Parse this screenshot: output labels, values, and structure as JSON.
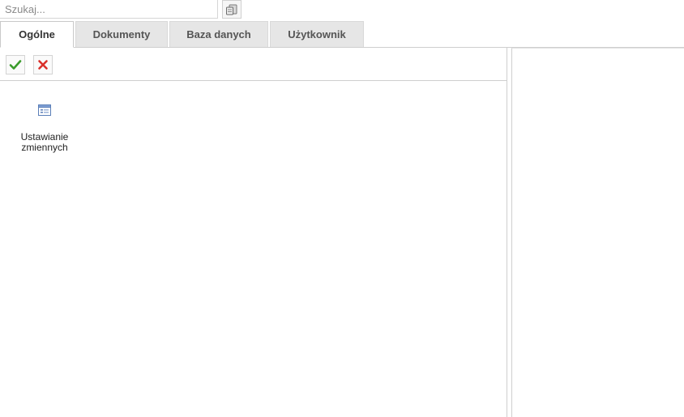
{
  "search": {
    "placeholder": "Szukaj...",
    "value": ""
  },
  "tabs": [
    {
      "label": "Ogólne",
      "active": true
    },
    {
      "label": "Dokumenty",
      "active": false
    },
    {
      "label": "Baza danych",
      "active": false
    },
    {
      "label": "Użytkownik",
      "active": false
    }
  ],
  "toolbar": {
    "ok_icon": "checkmark-icon",
    "cancel_icon": "x-icon",
    "colors": {
      "ok": "#3a9b2b",
      "cancel": "#d9302a"
    }
  },
  "items": [
    {
      "label": "Ustawianie\nzmiennych",
      "icon": "window-form-icon"
    }
  ]
}
